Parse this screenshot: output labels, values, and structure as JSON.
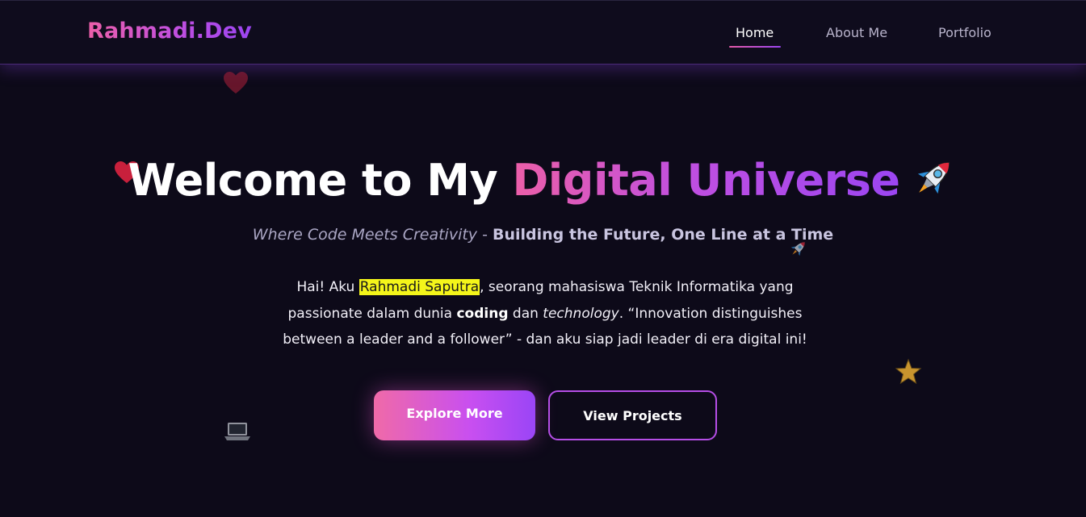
{
  "brand": {
    "name": "Rahmadi.Dev"
  },
  "nav": {
    "items": [
      {
        "label": "Home",
        "active": true
      },
      {
        "label": "About Me",
        "active": false
      },
      {
        "label": "Portfolio",
        "active": false
      }
    ]
  },
  "hero": {
    "title_plain": "Welcome to My ",
    "title_gradient": "Digital Universe",
    "subtitle_italic": "Where Code Meets Creativity",
    "subtitle_sep": " - ",
    "subtitle_bold": "Building the Future, One Line at a Time",
    "desc": {
      "p1": "Hai! Aku ",
      "name": "Rahmadi Saputra",
      "p2": ", seorang mahasiswa Teknik Informatika yang passionate dalam dunia ",
      "bold": "coding",
      "p3": " dan ",
      "italic": "technology",
      "p4": ". “Innovation distinguishes between a leader and a follower” - dan aku siap jadi leader di era digital ini!"
    },
    "buttons": {
      "primary": "Explore More",
      "secondary": "View Projects"
    }
  },
  "decor": {
    "icons": [
      "heart-icon",
      "heart-icon",
      "rocket-icon",
      "rocket-icon",
      "star-icon",
      "laptop-icon"
    ]
  },
  "colors": {
    "background": "#0d0a19",
    "accent_pink": "#ec5fa8",
    "accent_purple": "#9b45f2",
    "highlight": "#f4f51a"
  }
}
